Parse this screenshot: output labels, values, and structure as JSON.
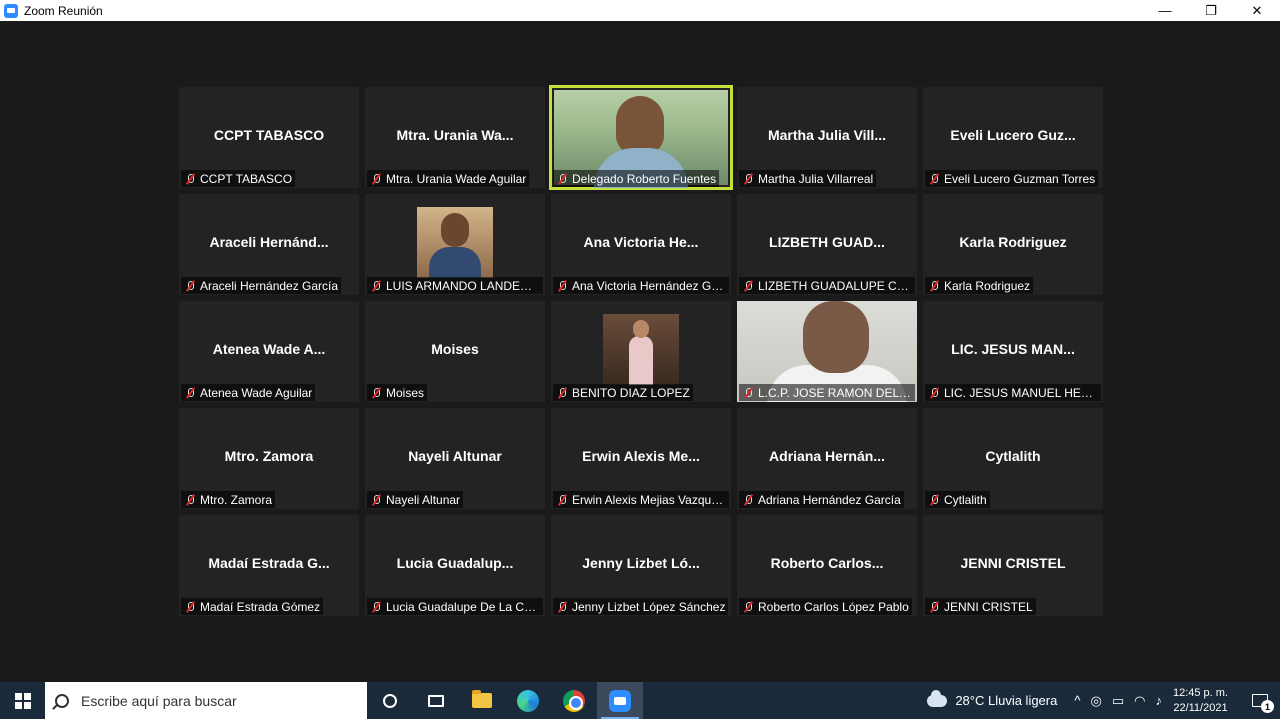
{
  "window": {
    "title": "Zoom Reunión",
    "minimize_glyph": "—",
    "maximize_glyph": "❐",
    "close_glyph": "✕"
  },
  "participants": [
    {
      "big": "CCPT TABASCO",
      "label": "CCPT TABASCO"
    },
    {
      "big": "Mtra.  Urania  Wa...",
      "label": "Mtra. Urania Wade Aguilar"
    },
    {
      "big": "",
      "label": "Delegado Roberto Fuentes",
      "video": "roberto",
      "active": true
    },
    {
      "big": "Martha  Julia  Vill...",
      "label": "Martha Julia Villarreal"
    },
    {
      "big": "Eveli  Lucero  Guz...",
      "label": "Eveli Lucero Guzman Torres"
    },
    {
      "big": "Araceli  Hernánd...",
      "label": "Araceli Hernández García"
    },
    {
      "big": "",
      "label": "LUIS ARMANDO LANDERO...",
      "video": "luis"
    },
    {
      "big": "Ana  Victoria  He...",
      "label": "Ana Victoria Hernández Go..."
    },
    {
      "big": "LIZBETH  GUAD...",
      "label": "LIZBETH GUADALUPE CAST..."
    },
    {
      "big": "Karla  Rodriguez",
      "label": "Karla Rodriguez"
    },
    {
      "big": "Atenea  Wade  A...",
      "label": "Atenea Wade Aguilar"
    },
    {
      "big": "Moises",
      "label": "Moises"
    },
    {
      "big": "",
      "label": "BENITO DIAZ LOPEZ",
      "video": "benito"
    },
    {
      "big": "",
      "label": "L.C.P. JOSE RAMON DEL C...",
      "video": "jose"
    },
    {
      "big": "LIC.  JESUS  MAN...",
      "label": "LIC. JESUS MANUEL HERN..."
    },
    {
      "big": "Mtro.  Zamora",
      "label": "Mtro. Zamora"
    },
    {
      "big": "Nayeli  Altunar",
      "label": "Nayeli Altunar"
    },
    {
      "big": "Erwin  Alexis  Me...",
      "label": "Erwin Alexis Mejias Vazque..."
    },
    {
      "big": "Adriana  Hernán...",
      "label": "Adriana Hernández García"
    },
    {
      "big": "Cytlalith",
      "label": "Cytlalith"
    },
    {
      "big": "Madaí  Estrada  G...",
      "label": "Madaí Estrada Gómez"
    },
    {
      "big": "Lucia  Guadalup...",
      "label": "Lucia Guadalupe De La Cru..."
    },
    {
      "big": "Jenny  Lizbet  Ló...",
      "label": "Jenny Lizbet López Sánchez"
    },
    {
      "big": "Roberto  Carlos...",
      "label": "Roberto Carlos López Pablo"
    },
    {
      "big": "JENNI  CRISTEL",
      "label": "JENNI CRISTEL"
    }
  ],
  "taskbar": {
    "search_placeholder": "Escribe aquí para buscar",
    "weather": "28°C  Lluvia ligera",
    "time": "12:45 p. m.",
    "date": "22/11/2021",
    "notifications": "1",
    "tray_chevron": "^"
  }
}
